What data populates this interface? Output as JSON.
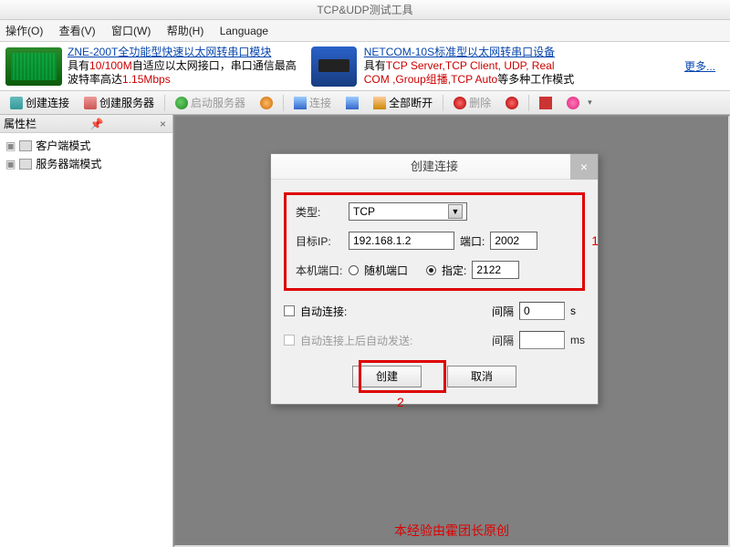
{
  "window": {
    "title": "TCP&UDP测试工具"
  },
  "menu": {
    "op": "操作(O)",
    "view": "查看(V)",
    "win": "窗口(W)",
    "help": "帮助(H)",
    "lang": "Language"
  },
  "ad1": {
    "link": "ZNE-200T全功能型快速以太网转串口模块",
    "line2a": "具有",
    "line2b": "10/100M",
    "line2c": "自适应以太网接口，串口通信最高",
    "line3a": "波特率高达",
    "line3b": "1.15Mbps"
  },
  "ad2": {
    "link": "NETCOM-10S标准型以太网转串口设备",
    "line2a": "具有",
    "line2b": "TCP Server,TCP Client, UDP, Real",
    "line3a": "COM ,Group组播,TCP Auto",
    "line3b": "等多种工作模式"
  },
  "more": "更多...",
  "toolbar": {
    "create_conn": "创建连接",
    "create_srv": "创建服务器",
    "start_srv": "启动服务器",
    "connect": "连接",
    "disc_all": "全部断开",
    "delete": "删除"
  },
  "sidebar": {
    "title": "属性栏",
    "items": [
      "客户端模式",
      "服务器端模式"
    ]
  },
  "dialog": {
    "title": "创建连接",
    "type_label": "类型:",
    "type_value": "TCP",
    "ip_label": "目标IP:",
    "ip_value": "192.168.1.2",
    "port_label": "端口:",
    "port_value": "2002",
    "local_port_label": "本机端口:",
    "radio_random": "随机端口",
    "radio_fixed": "指定:",
    "local_port_value": "2122",
    "auto_conn": "自动连接:",
    "interval1": "间隔",
    "interval1_val": "0",
    "unit_s": "s",
    "auto_send": "自动连接上后自动发送:",
    "interval2": "间隔",
    "interval2_val": "",
    "unit_ms": "ms",
    "ok": "创建",
    "cancel": "取消",
    "anno1": "1",
    "anno2": "2"
  },
  "credit": "本经验由霍团长原创"
}
